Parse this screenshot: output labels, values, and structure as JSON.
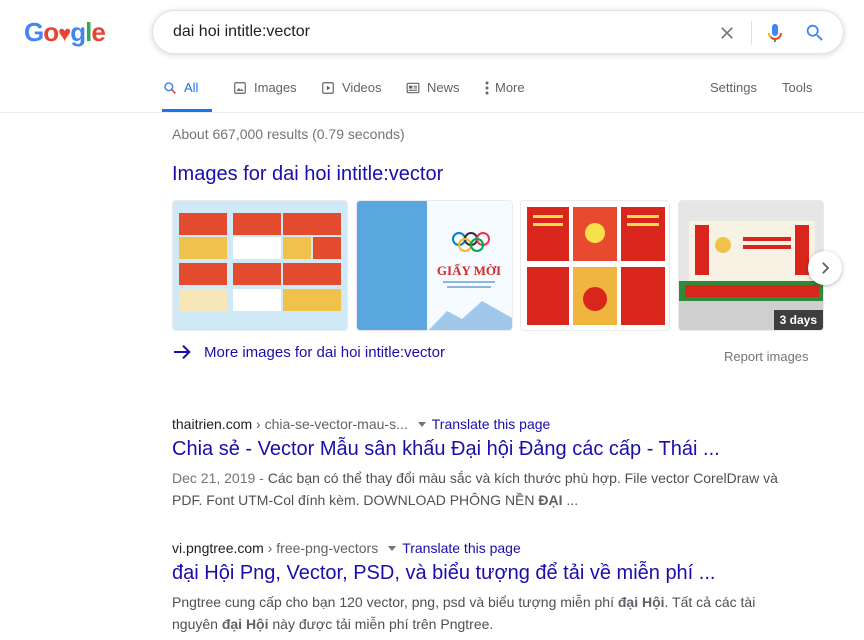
{
  "logo": {
    "text": "Google",
    "parts": [
      "G",
      "o",
      "♥",
      "g",
      "l",
      "e"
    ]
  },
  "search": {
    "query": "dai hoi intitle:vector"
  },
  "tabs": {
    "all": "All",
    "images": "Images",
    "videos": "Videos",
    "news": "News",
    "more": "More",
    "settings": "Settings",
    "tools": "Tools"
  },
  "stats": "About 667,000 results (0.79 seconds)",
  "image_block": {
    "heading": "Images for dai hoi intitle:vector",
    "thumb2_title": "GIẤY MỜI",
    "thumb4_badge": "3 days",
    "more_link": "More images for dai hoi intitle:vector",
    "report": "Report images"
  },
  "results": [
    {
      "domain": "thaitrien.com",
      "path": " › chia-se-vector-mau-s...",
      "translate": "Translate this page",
      "title": "Chia sẻ - Vector Mẫu sân khấu Đại hội Đảng các cấp - Thái ...",
      "date": "Dec 21, 2019",
      "sep": " - ",
      "snippet_1": "Các bạn có thể thay đổi màu sắc và kích thước phù hợp. File vector CorelDraw và PDF. Font UTM-Col đính kèm. DOWNLOAD PHÔNG NỀN ",
      "snippet_bold_1": "ĐẠI",
      "snippet_2": " ..."
    },
    {
      "domain": "vi.pngtree.com",
      "path": " › free-png-vectors",
      "translate": "Translate this page",
      "title": "đại Hội Png, Vector, PSD, và biểu tượng để tải về miễn phí ...",
      "snippet_1": "Pngtree cung cấp cho bạn 120 vector, png, psd và biểu tượng miễn phí ",
      "snippet_bold_1": "đại Hội",
      "snippet_2": ". Tất cả các tài nguyên ",
      "snippet_bold_2": "đại Hội",
      "snippet_3": " này được tải miễn phí trên Pngtree."
    }
  ],
  "colors": {
    "link": "#1a0dab",
    "accent": "#1a73e8",
    "text": "#202124",
    "muted": "#70757a"
  }
}
